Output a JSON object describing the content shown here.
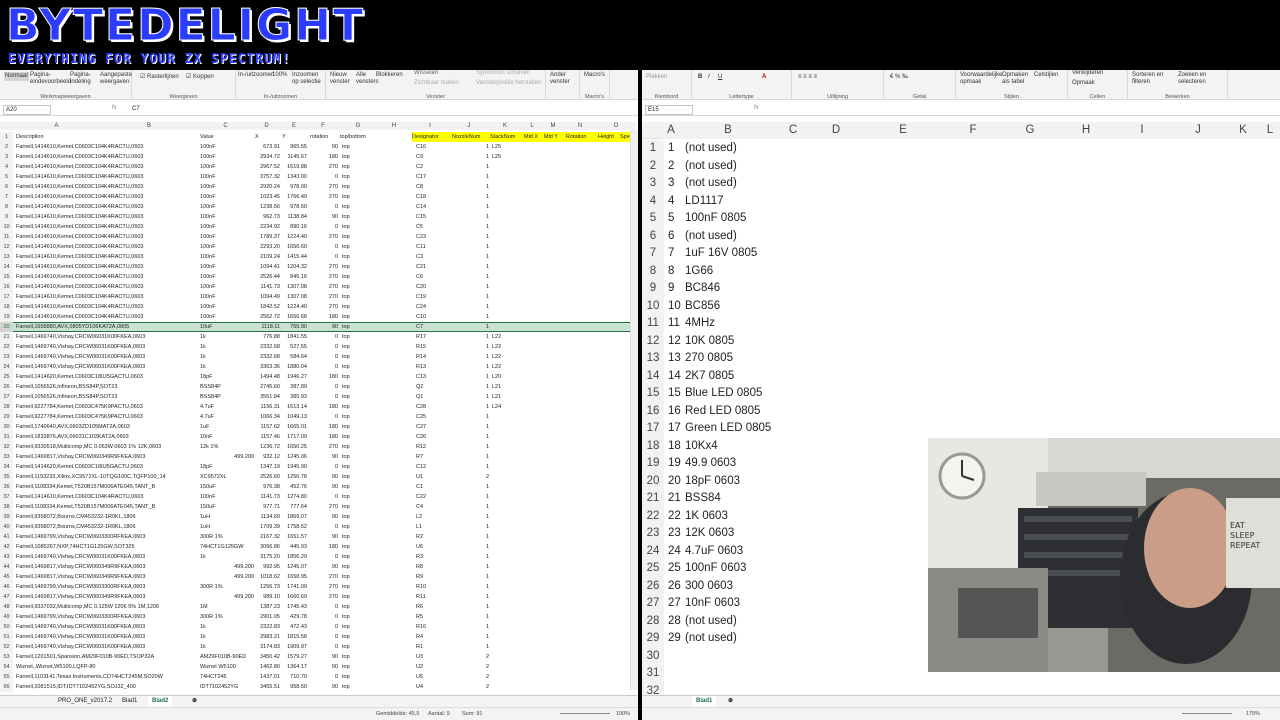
{
  "banner": {
    "title": "BYTEDELIGHT",
    "subtitle": "EVERYTHING FOR YOUR ZX SPECTRUM!"
  },
  "left": {
    "ribbon": {
      "view_buttons": [
        "Normaal",
        "Pagina-eindevoorbeeld",
        "Pagina-indeling",
        "Aangepaste weergaven"
      ],
      "checks": [
        "Rasterlijnen",
        "Koppen"
      ],
      "zoom_buttons": [
        "In-/uitzoomen",
        "100%",
        "Inzoomen op selectie"
      ],
      "window_buttons": [
        "Nieuw venster",
        "Alle vensters",
        "Blokkeren",
        "Wisselen",
        "Zichtbaar maken",
        "Synchroon schuiven",
        "Vensterpositie herstellen"
      ],
      "other_buttons": [
        "Ander venster",
        "Macro's"
      ],
      "groups": [
        "Werkmapweergaven",
        "Weergeven",
        "In-/uitzoomen",
        "Venster",
        "Macro's"
      ]
    },
    "name_box": "A20",
    "fx": "fx",
    "formula": "C7",
    "col_letters": [
      "A",
      "B",
      "C",
      "D",
      "E",
      "F",
      "G",
      "H",
      "I",
      "J",
      "K",
      "L",
      "M",
      "N",
      "O"
    ],
    "headers": [
      "Description",
      "Value",
      "X",
      "Y",
      "rotation",
      "top/bottom",
      "Designator",
      "NozzleNum",
      "StackNum",
      "Mid X",
      "Mid Y",
      "Rotation",
      "Height",
      "Spe"
    ],
    "rows": [
      [
        "Farnell,1414610,Kemet,C0603C104K4RACTU,0603",
        "100nF",
        "673.91",
        "965.55",
        "90",
        "top",
        "C16",
        "1",
        "L25"
      ],
      [
        "Farnell,1414610,Kemet,C0603C104K4RACTU,0603",
        "100nF",
        "2934.72",
        "1145.67",
        "180",
        "top",
        "C9",
        "1",
        "L25"
      ],
      [
        "Farnell,1414610,Kemet,C0603C104K4RACTU,0603",
        "100nF",
        "2967.52",
        "1619.88",
        "270",
        "top",
        "C2",
        "1",
        ""
      ],
      [
        "Farnell,1414610,Kemet,C0603C104K4RACTU,0603",
        "100nF",
        "3757.32",
        "1343.00",
        "0",
        "top",
        "C17",
        "1",
        ""
      ],
      [
        "Farnell,1414610,Kemet,C0603C104K4RACTU,0603",
        "100nF",
        "2920.24",
        "978.00",
        "270",
        "top",
        "C8",
        "1",
        ""
      ],
      [
        "Farnell,1414610,Kemet,C0603C104K4RACTU,0603",
        "100nF",
        "1023.45",
        "1766.49",
        "270",
        "top",
        "C18",
        "1",
        ""
      ],
      [
        "Farnell,1414610,Kemet,C0603C104K4RACTU,0603",
        "100nF",
        "1238.56",
        "978.60",
        "0",
        "top",
        "C14",
        "1",
        ""
      ],
      [
        "Farnell,1414610,Kemet,C0603C104K4RACTU,0603",
        "100nF",
        "962.73",
        "1138.84",
        "90",
        "top",
        "C15",
        "1",
        ""
      ],
      [
        "Farnell,1414610,Kemet,C0603C104K4RACTU,0603",
        "100nF",
        "2234.92",
        "890.16",
        "0",
        "top",
        "C5",
        "1",
        ""
      ],
      [
        "Farnell,1414610,Kemet,C0603C104K4RACTU,0603",
        "100nF",
        "1789.37",
        "1224.40",
        "270",
        "top",
        "C23",
        "1",
        ""
      ],
      [
        "Farnell,1414610,Kemet,C0603C104K4RACTU,0603",
        "100nF",
        "2293.20",
        "1656.60",
        "0",
        "top",
        "C11",
        "1",
        ""
      ],
      [
        "Farnell,1414610,Kemet,C0603C104K4RACTU,0603",
        "100nF",
        "2109.24",
        "1415.44",
        "0",
        "top",
        "C3",
        "1",
        ""
      ],
      [
        "Farnell,1414610,Kemet,C0603C104K4RACTU,0603",
        "100nF",
        "1094.41",
        "1204.32",
        "270",
        "top",
        "C21",
        "1",
        ""
      ],
      [
        "Farnell,1414610,Kemet,C0603C104K4RACTU,0603",
        "100nF",
        "2526.44",
        "845.16",
        "270",
        "top",
        "C6",
        "1",
        ""
      ],
      [
        "Farnell,1414610,Kemet,C0603C104K4RACTU,0603",
        "100nF",
        "1141.73",
        "1307.08",
        "270",
        "top",
        "C20",
        "1",
        ""
      ],
      [
        "Farnell,1414610,Kemet,C0603C104K4RACTU,0603",
        "100nF",
        "1094.49",
        "1307.08",
        "270",
        "top",
        "C19",
        "1",
        ""
      ],
      [
        "Farnell,1414610,Kemet,C0603C104K4RACTU,0603",
        "100nF",
        "1842.52",
        "1224.40",
        "270",
        "top",
        "C24",
        "1",
        ""
      ],
      [
        "Farnell,1414610,Kemet,C0603C104K4RACTU,0603",
        "100nF",
        "2562.72",
        "1656.68",
        "180",
        "top",
        "C10",
        "1",
        ""
      ],
      [
        "Farnell,1658880,AVX,0805YD106KAT2A,0805",
        "10uF",
        "1118.11",
        "755.90",
        "90",
        "top",
        "C7",
        "1",
        ""
      ],
      [
        "Farnell,1469740,Vishay,CRCW06031K00FKEA,0603",
        "1k",
        "776.88",
        "1841.55",
        "0",
        "top",
        "R17",
        "1",
        "L22"
      ],
      [
        "Farnell,1469740,Vishay,CRCW06031K00FKEA,0603",
        "1k",
        "2332.68",
        "527.55",
        "0",
        "top",
        "R15",
        "1",
        "L22"
      ],
      [
        "Farnell,1469740,Vishay,CRCW06031K00FKEA,0603",
        "1k",
        "2332.68",
        "584.64",
        "0",
        "top",
        "R14",
        "1",
        "L22"
      ],
      [
        "Farnell,1469740,Vishay,CRCW06031K00FKEA,0603",
        "1k",
        "3363.36",
        "1880.04",
        "0",
        "top",
        "R13",
        "1",
        "L22"
      ],
      [
        "Farnell,1414620,Kemet,C0603C180J5GACTU,0603",
        "18pF",
        "1494.48",
        "1946.27",
        "180",
        "top",
        "C13",
        "1",
        "L20"
      ],
      [
        "Farnell,1056526,Infineon,BSS84P,SOT23",
        "BSS84P",
        "2745.60",
        "387.89",
        "0",
        "top",
        "Q2",
        "1",
        "L21"
      ],
      [
        "Farnell,1056526,Infineon,BSS84P,SOT23",
        "BSS84P",
        "3561.84",
        "385.93",
        "0",
        "top",
        "Q1",
        "1",
        "L21"
      ],
      [
        "Farnell,9227784,Kemet,C0603C475K9PACTU,0603",
        "4.7uF",
        "1156.31",
        "1613.14",
        "180",
        "top",
        "C28",
        "1",
        "L24"
      ],
      [
        "Farnell,9227784,Kemet,C0603C475K9PACTU,0603",
        "4.7uF",
        "1066.34",
        "1049.13",
        "0",
        "top",
        "C25",
        "1",
        ""
      ],
      [
        "Farnell,1740640,AVX,0603ZD105MAT2A,0603",
        "1uF",
        "1157.62",
        "1665.01",
        "180",
        "top",
        "C27",
        "1",
        ""
      ],
      [
        "Farnell,1833876,AVX,06031C103KAT2A,0603",
        "10nF",
        "1157.46",
        "1717.09",
        "180",
        "top",
        "C26",
        "1",
        ""
      ],
      [
        "Farnell,9330518,Multicomp,MC 0.063W 0603 1% 12K,0603",
        "12k 1%",
        "1236.72",
        "1650.25",
        "270",
        "top",
        "R12",
        "1",
        ""
      ],
      [
        "Farnell,1469817,Vishay,CRCW060349R9FKEA,0603",
        "499.200",
        "932.12",
        "1245.06",
        "90",
        "top",
        "R7",
        "1",
        ""
      ],
      [
        "Farnell,1414620,Kemet,C0603C180J5GACTU,0603",
        "18pF",
        "1347.19",
        "1945.90",
        "0",
        "top",
        "C12",
        "1",
        ""
      ],
      [
        "Farnell,1193233,Xilinx,XC9572XL-10TQG100C,TQFP100_14",
        "XC9572XL",
        "2526.60",
        "1256.78",
        "90",
        "top",
        "U1",
        "2",
        ""
      ],
      [
        "Farnell,1108334,Kemet,T520B157M006ATE045,TANT_B",
        "150uF",
        "976.38",
        "452.76",
        "90",
        "top",
        "C1",
        "1",
        ""
      ],
      [
        "Farnell,1414610,Kemet,C0603C104K4RACTU,0603",
        "100nF",
        "1141.73",
        "1274.80",
        "0",
        "top",
        "C22",
        "1",
        ""
      ],
      [
        "Farnell,1108334,Kemet,T520B157M006ATE045,TANT_B",
        "150uF",
        "977.71",
        "777.64",
        "270",
        "top",
        "C4",
        "1",
        ""
      ],
      [
        "Farnell,9358072,Bourns,CM453232-1R0KL,1806",
        "1uH",
        "1134.69",
        "1869.07",
        "90",
        "top",
        "L2",
        "1",
        ""
      ],
      [
        "Farnell,9358072,Bourns,CM453232-1R0KL,1806",
        "1uH",
        "1709.39",
        "1758.52",
        "0",
        "top",
        "L1",
        "1",
        ""
      ],
      [
        "Farnell,1469799,Vishay,CRCW0603300RFKEA,0603",
        "300R 1%",
        "2167.32",
        "1651.57",
        "90",
        "top",
        "R2",
        "1",
        ""
      ],
      [
        "Farnell,1085267,NXP,74HCT1G125GW,SOT325",
        "74HCT1G125GW",
        "3066.86",
        "445.93",
        "180",
        "top",
        "U6",
        "1",
        ""
      ],
      [
        "Farnell,1469740,Vishay,CRCW06031K00FKEA,0603",
        "1k",
        "3175.20",
        "1856.29",
        "0",
        "top",
        "R3",
        "1",
        ""
      ],
      [
        "Farnell,1469817,Vishay,CRCW060349R9FKEA,0603",
        "499.200",
        "992.95",
        "1245.07",
        "90",
        "top",
        "R8",
        "1",
        ""
      ],
      [
        "Farnell,1469817,Vishay,CRCW060349R9FKEA,0603",
        "499.200",
        "1018.62",
        "1658.95",
        "270",
        "top",
        "R9",
        "1",
        ""
      ],
      [
        "Farnell,1469799,Vishay,CRCW0603300RFKEA,0603",
        "300R 1%",
        "1256.73",
        "1741.09",
        "270",
        "top",
        "R10",
        "1",
        ""
      ],
      [
        "Farnell,1469817,Vishay,CRCW060349R9FKEA,0603",
        "499.200",
        "989.10",
        "1660.69",
        "270",
        "top",
        "R11",
        "1",
        ""
      ],
      [
        "Farnell,9337032,Multicomp,MC 0.125W 1206 5% 1M,1206",
        "1M",
        "1387.23",
        "1745.43",
        "0",
        "top",
        "R6",
        "1",
        ""
      ],
      [
        "Farnell,1469799,Vishay,CRCW0603300RFKEA,0603",
        "300R 1%",
        "2901.05",
        "429.78",
        "0",
        "top",
        "R5",
        "1",
        ""
      ],
      [
        "Farnell,1469740,Vishay,CRCW06031K00FKEA,0603",
        "1k",
        "2322.83",
        "472.43",
        "0",
        "top",
        "R16",
        "1",
        ""
      ],
      [
        "Farnell,1469740,Vishay,CRCW06031K00FKEA,0603",
        "1k",
        "2983.21",
        "1815.58",
        "0",
        "top",
        "R4",
        "1",
        ""
      ],
      [
        "Farnell,1469740,Vishay,CRCW06031K00FKEA,0603",
        "1k",
        "3174.83",
        "1909.97",
        "0",
        "top",
        "R1",
        "1",
        ""
      ],
      [
        "Farnell,1201501,Spansion,AM29F010B-90ED,TSOP32A",
        "AM29F010B-90ED",
        "3450.42",
        "1579.27",
        "90",
        "top",
        "U3",
        "2",
        ""
      ],
      [
        "Wiznet,,Wiznet,W5100,LQFP-80",
        "Wiznet W5100",
        "1462.80",
        "1364.17",
        "90",
        "top",
        "U2",
        "2",
        ""
      ],
      [
        "Farnell,1103141,Texas Instruments,CD74HCT245M,SO20W",
        "74HCT245",
        "1437.01",
        "710.70",
        "0",
        "top",
        "U5",
        "2",
        ""
      ],
      [
        "Farnell,1081515,IDT,IDT7102452YG,SOJ32_400",
        "IDT7102452YG",
        "3455.51",
        "958.50",
        "90",
        "top",
        "U4",
        "2",
        ""
      ]
    ],
    "tabs": [
      "PRO_ONE_v2017.2",
      "Blad1",
      "Blad2"
    ],
    "active_tab": "Blad2",
    "status": {
      "average": "Gemiddelde: 45,5",
      "count": "Aantal: 9",
      "sum": "Som: 91",
      "zoom": "100%"
    }
  },
  "right": {
    "ribbon": {
      "buttons": [
        "Plakken",
        "Voorwaardelijke opmaak",
        "Opmaken als tabel",
        "Celstijlen",
        "Verwijderen",
        "Opmaak",
        "Sorteren en filteren",
        "Zoeken en selecteren"
      ],
      "groups": [
        "Klembord",
        "Lettertype",
        "Uitlijning",
        "Getal",
        "Stijlen",
        "Cellen",
        "Bewerken"
      ]
    },
    "name_box": "E15",
    "fx": "fx",
    "formula": "",
    "col_letters": [
      "A",
      "B",
      "C",
      "D",
      "E",
      "F",
      "G",
      "H",
      "I",
      "J",
      "K",
      "L"
    ],
    "rows": [
      [
        "1",
        "(not used)"
      ],
      [
        "2",
        "(not used)"
      ],
      [
        "3",
        "(not used)"
      ],
      [
        "4",
        "LD1117"
      ],
      [
        "5",
        "100nF 0805"
      ],
      [
        "6",
        "(not used)"
      ],
      [
        "7",
        "1uF 16V 0805"
      ],
      [
        "8",
        "1G66"
      ],
      [
        "9",
        "BC846"
      ],
      [
        "10",
        "BC856"
      ],
      [
        "11",
        "4MHz"
      ],
      [
        "12",
        "10K 0805"
      ],
      [
        "13",
        "270 0805"
      ],
      [
        "14",
        "2K7 0805"
      ],
      [
        "15",
        "Blue LED 0805"
      ],
      [
        "16",
        "Red LED 0805"
      ],
      [
        "17",
        "Green LED 0805"
      ],
      [
        "18",
        "10Kx4"
      ],
      [
        "19",
        "49.9 0603"
      ],
      [
        "20",
        "18pF 0603"
      ],
      [
        "21",
        "BSS84"
      ],
      [
        "22",
        "1K 0603"
      ],
      [
        "23",
        "12K 0603"
      ],
      [
        "24",
        "4.7uF 0603"
      ],
      [
        "25",
        "100nF 0603"
      ],
      [
        "26",
        "300 0603"
      ],
      [
        "27",
        "10nF 0603"
      ],
      [
        "28",
        "(not used)"
      ],
      [
        "29",
        "(not used)"
      ],
      [
        "",
        ""
      ],
      [
        "",
        ""
      ],
      [
        "",
        ""
      ]
    ],
    "tabs": [
      "Blad1"
    ],
    "status": {
      "zoom": "175%"
    }
  },
  "colors": {
    "excel_green": "#217346",
    "header_yellow": "#ffff00",
    "selected_row": "#c9e3d1"
  }
}
